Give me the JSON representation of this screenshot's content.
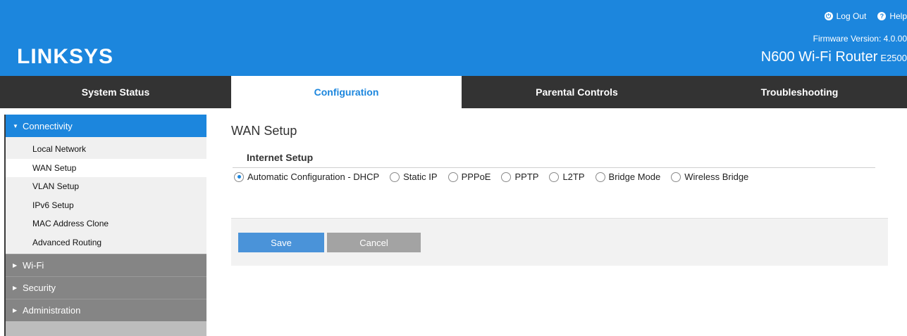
{
  "header": {
    "logo": "LINKSYS",
    "logout_label": "Log Out",
    "help_label": "Help",
    "firmware": "Firmware Version: 4.0.00",
    "model_name": "N600 Wi-Fi Router",
    "model_code": "E2500",
    "background_color": "#1c86dd"
  },
  "tabs": [
    {
      "label": "System Status",
      "active": false
    },
    {
      "label": "Configuration",
      "active": true
    },
    {
      "label": "Parental Controls",
      "active": false
    },
    {
      "label": "Troubleshooting",
      "active": false
    }
  ],
  "sidebar": {
    "sections": [
      {
        "label": "Connectivity",
        "expanded": true
      },
      {
        "label": "Wi-Fi",
        "expanded": false
      },
      {
        "label": "Security",
        "expanded": false
      },
      {
        "label": "Administration",
        "expanded": false
      }
    ],
    "items": [
      {
        "label": "Local Network"
      },
      {
        "label": "WAN Setup",
        "selected": true
      },
      {
        "label": "VLAN Setup"
      },
      {
        "label": "IPv6 Setup"
      },
      {
        "label": "MAC Address Clone"
      },
      {
        "label": "Advanced Routing"
      }
    ]
  },
  "main": {
    "title": "WAN Setup",
    "section_title": "Internet Setup",
    "connection_types": [
      {
        "label": "Automatic Configuration - DHCP",
        "checked": true
      },
      {
        "label": "Static IP",
        "checked": false
      },
      {
        "label": "PPPoE",
        "checked": false
      },
      {
        "label": "PPTP",
        "checked": false
      },
      {
        "label": "L2TP",
        "checked": false
      },
      {
        "label": "Bridge Mode",
        "checked": false
      },
      {
        "label": "Wireless Bridge",
        "checked": false
      }
    ],
    "save_label": "Save",
    "cancel_label": "Cancel"
  }
}
